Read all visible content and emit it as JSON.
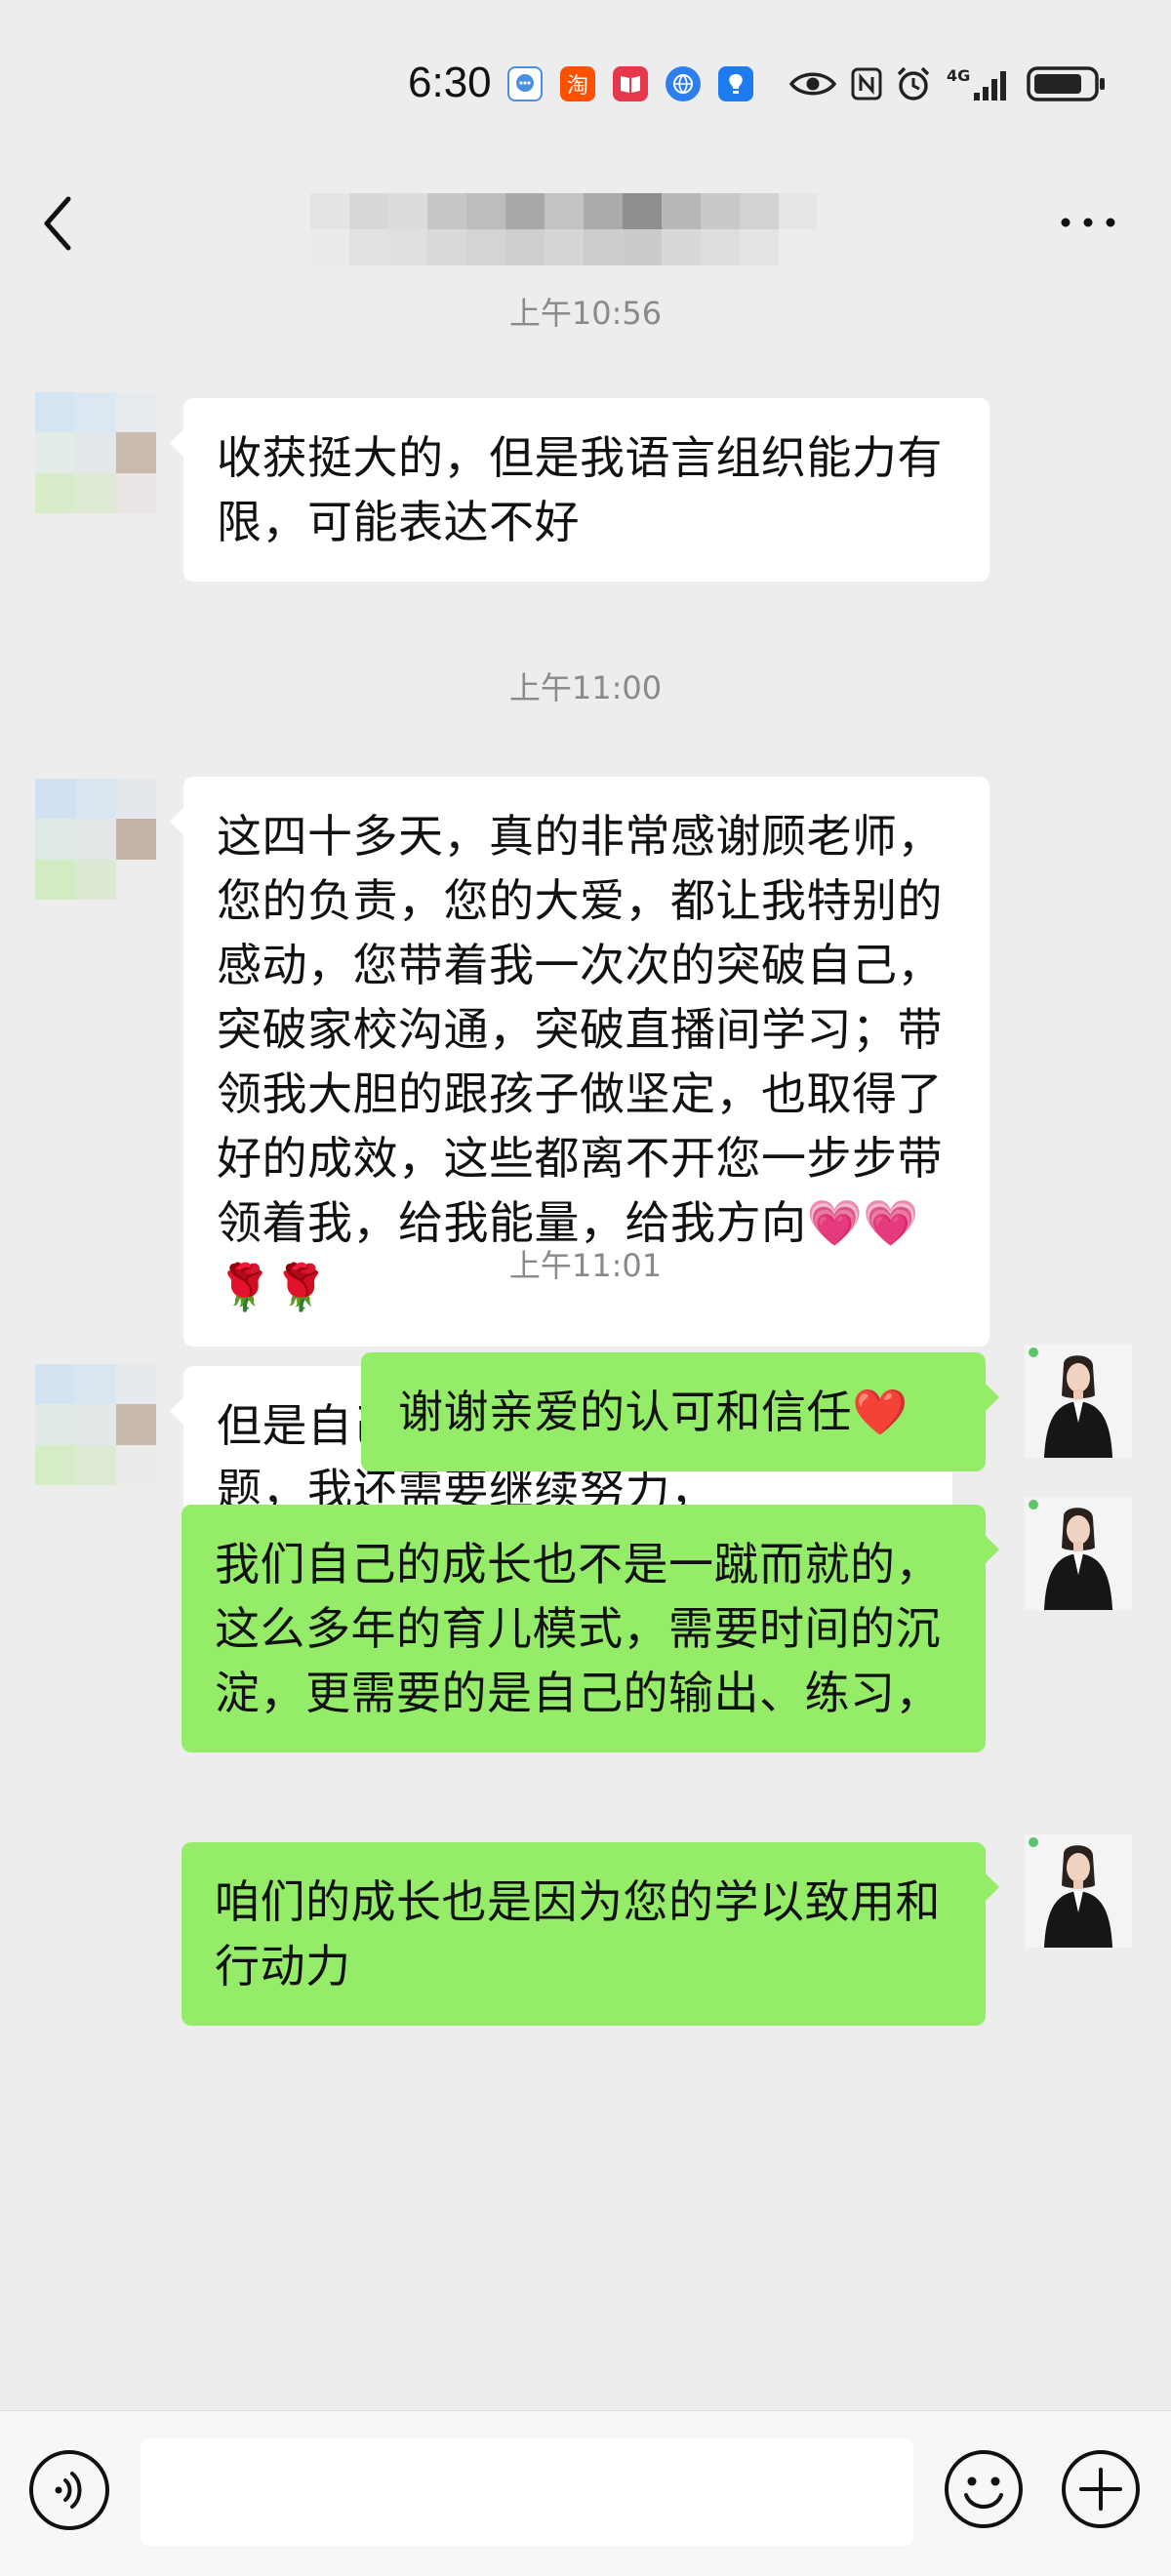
{
  "status_bar": {
    "time": "6:30",
    "app_icons": [
      "chat-bubble-app-icon",
      "taobao-app-icon",
      "book-app-icon",
      "browser-app-icon",
      "lightbulb-app-icon"
    ],
    "taobao_label": "淘",
    "system_icons": [
      "eye-icon",
      "nfc-icon",
      "alarm-icon",
      "4g-signal-icon",
      "battery-icon"
    ],
    "network": "4G"
  },
  "colors": {
    "background": "#ededed",
    "green_bubble": "#95ec69",
    "white_bubble": "#ffffff",
    "timestamp": "#8a8a8a"
  },
  "chat": {
    "timestamps": [
      "上午10:56",
      "上午11:00",
      "上午11:01"
    ],
    "incoming": [
      "收获挺大的，但是我语言组织能力有限，可能表达不好",
      "这四十多天，真的非常感谢顾老师，您的负责，您的大爱，都让我特别的感动，您带着我一次次的突破自己，突破家校沟通，突破直播间学习；带领我大胆的跟孩子做坚定，也取得了好的成效，这些都离不开您一步步带领着我，给我能量，给我方向",
      "但是自己现在还是存在很多的问题，我还需要继续努力，"
    ],
    "incoming_emojis": [
      "💗",
      "💗",
      "🌹",
      "🌹"
    ],
    "outgoing": [
      "谢谢亲爱的认可和信任",
      "我们自己的成长也不是一蹴而就的，这么多年的育儿模式，需要时间的沉淀，更需要的是自己的输出、练习，",
      "咱们的成长也是因为您的学以致用和行动力"
    ],
    "outgoing_emoji": "❤️"
  },
  "input_bar": {
    "placeholder": "",
    "icons": [
      "voice-icon",
      "emoji-icon",
      "plus-icon"
    ]
  }
}
